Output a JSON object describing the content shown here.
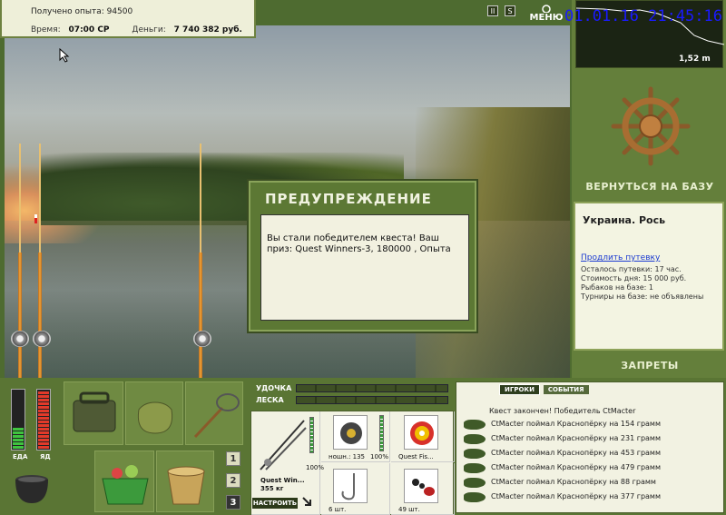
{
  "top_info": {
    "experience_label": "Получено опыта: 94500",
    "time_label": "Время:",
    "time_value": "07:00 СР",
    "money_label": "Деньги:",
    "money_value": "7 740 382 руб."
  },
  "top_buttons": {
    "pause": "II",
    "sound": "S",
    "menu": "МЕНЮ"
  },
  "clock": "01.01.16 21:45:16",
  "depth": "1,52 m",
  "right_panel": {
    "return_label": "ВЕРНУТЬСЯ НА БАЗУ",
    "location": "Украина. Рось",
    "extend_link": "Продлить путевку",
    "info": [
      "Осталось путевки: 17 час.",
      "Стоимость дня: 15 000 руб.",
      "Рыбаков на базе: 1",
      "Турниры на базе: не объявлены"
    ],
    "bans_label": "ЗАПРЕТЫ"
  },
  "dialog": {
    "title": "ПРЕДУПРЕЖДЕНИЕ",
    "message": "Вы стали победителем квеста! Ваш приз: Quest Winners-3, 180000 , Опыта"
  },
  "status": {
    "food_label": "ЕДА",
    "poison_label": "ЯД",
    "food_level": 0.35,
    "poison_level": 0.95
  },
  "inventory_tabs": [
    "1",
    "2",
    "3"
  ],
  "tackle": {
    "rod_label": "УДОЧКА",
    "line_label": "ЛЕСКА",
    "rod_name": "Quest Win...",
    "rod_weight": "355 кг",
    "rod_percent": "100%",
    "reel_caption": "ношн.: 135",
    "reel_percent": "100%",
    "line_name": "Quest Fis...",
    "hook_count": "6 шт.",
    "bait_count": "49 шт.",
    "adjust_label": "НАСТРОИТЬ"
  },
  "events": {
    "tabs": [
      "ИГРОКИ",
      "СОБЫТИЯ"
    ],
    "header": "Квест закончен! Победитель CtMacter",
    "items": [
      "CtMacter поймал Краснопёрку на 154 грамм",
      "CtMacter поймал Краснопёрку на 231 грамм",
      "CtMacter поймал Краснопёрку на 453 грамм",
      "CtMacter поймал Краснопёрку на 479 грамм",
      "CtMacter поймал Краснопёрку на 88 грамм",
      "CtMacter поймал Краснопёрку на 377 грамм"
    ]
  }
}
